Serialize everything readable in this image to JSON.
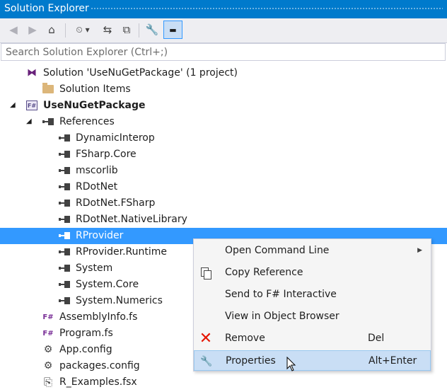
{
  "window": {
    "title": "Solution Explorer"
  },
  "toolbar": {
    "buttons": [
      {
        "icon": "back-icon",
        "glyph": "◀",
        "enabled": false
      },
      {
        "icon": "forward-icon",
        "glyph": "▶",
        "enabled": false
      },
      {
        "icon": "home-icon",
        "glyph": "⌂",
        "enabled": true
      },
      {
        "icon": "pending-changes-filter-icon",
        "glyph": "⏲",
        "enabled": true
      },
      {
        "icon": "sync-with-active-document-icon",
        "glyph": "⇆",
        "enabled": true
      },
      {
        "icon": "collapse-all-icon",
        "glyph": "⧉",
        "enabled": true
      },
      {
        "icon": "properties-wrench-icon",
        "glyph": "🔧",
        "enabled": true
      },
      {
        "icon": "preview-selected-items-icon",
        "glyph": "▬",
        "enabled": true,
        "active": true
      }
    ]
  },
  "search": {
    "placeholder": "Search Solution Explorer (Ctrl+;)"
  },
  "tree": [
    {
      "label": "Solution 'UseNuGetPackage' (1 project)",
      "icon": "solution-icon",
      "level": 0,
      "expander": ""
    },
    {
      "label": "Solution Items",
      "icon": "folder-icon",
      "level": 1,
      "expander": ""
    },
    {
      "label": "UseNuGetPackage",
      "icon": "fsharp-project-icon",
      "level": 0,
      "expander": "◢",
      "bold": true
    },
    {
      "label": "References",
      "icon": "references-icon",
      "level": 1,
      "expander": "◢"
    },
    {
      "label": "DynamicInterop",
      "icon": "reference-icon",
      "level": 2,
      "expander": ""
    },
    {
      "label": "FSharp.Core",
      "icon": "reference-icon",
      "level": 2,
      "expander": ""
    },
    {
      "label": "mscorlib",
      "icon": "reference-icon",
      "level": 2,
      "expander": ""
    },
    {
      "label": "RDotNet",
      "icon": "reference-icon",
      "level": 2,
      "expander": ""
    },
    {
      "label": "RDotNet.FSharp",
      "icon": "reference-icon",
      "level": 2,
      "expander": ""
    },
    {
      "label": "RDotNet.NativeLibrary",
      "icon": "reference-icon",
      "level": 2,
      "expander": ""
    },
    {
      "label": "RProvider",
      "icon": "reference-icon",
      "level": 2,
      "expander": "",
      "selected": true
    },
    {
      "label": "RProvider.Runtime",
      "icon": "reference-icon",
      "level": 2,
      "expander": ""
    },
    {
      "label": "System",
      "icon": "reference-icon",
      "level": 2,
      "expander": ""
    },
    {
      "label": "System.Core",
      "icon": "reference-icon",
      "level": 2,
      "expander": ""
    },
    {
      "label": "System.Numerics",
      "icon": "reference-icon",
      "level": 2,
      "expander": ""
    },
    {
      "label": "AssemblyInfo.fs",
      "icon": "fsharp-file-icon",
      "level": 1,
      "expander": ""
    },
    {
      "label": "Program.fs",
      "icon": "fsharp-file-icon",
      "level": 1,
      "expander": ""
    },
    {
      "label": "App.config",
      "icon": "config-file-icon",
      "level": 1,
      "expander": ""
    },
    {
      "label": "packages.config",
      "icon": "config-file-icon",
      "level": 1,
      "expander": ""
    },
    {
      "label": "R_Examples.fsx",
      "icon": "script-file-icon",
      "level": 1,
      "expander": ""
    }
  ],
  "context_menu": {
    "items": [
      {
        "label": "Open Command Line",
        "shortcut": "",
        "icon": "",
        "submenu": true
      },
      {
        "label": "Copy Reference",
        "shortcut": "",
        "icon": "copy-icon"
      },
      {
        "label": "Send to F# Interactive",
        "shortcut": "",
        "icon": ""
      },
      {
        "label": "View in Object Browser",
        "shortcut": "",
        "icon": ""
      },
      {
        "label": "Remove",
        "shortcut": "Del",
        "icon": "remove-icon"
      },
      {
        "label": "Properties",
        "shortcut": "Alt+Enter",
        "icon": "wrench-icon",
        "highlighted": true
      }
    ]
  },
  "colors": {
    "title_bar": "#007acc",
    "selection": "#3399ff",
    "menu_highlight": "#c9def5",
    "remove_icon": "#e51400"
  }
}
